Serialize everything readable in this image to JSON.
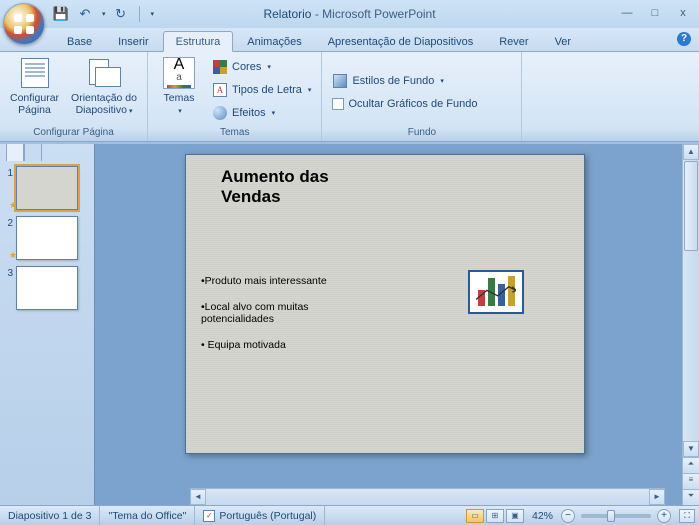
{
  "title": {
    "doc": "Relatorio",
    "app": "Microsoft PowerPoint"
  },
  "qat": {
    "save": "💾",
    "undo": "↶",
    "redo": "↻"
  },
  "window": {
    "min": "—",
    "max": "□",
    "close": "x"
  },
  "tabs": {
    "home": "Base",
    "insert": "Inserir",
    "design": "Estrutura",
    "anim": "Animações",
    "show": "Apresentação de Diapositivos",
    "review": "Rever",
    "view": "Ver"
  },
  "ribbon": {
    "page_setup_group": "Configurar Página",
    "page_setup": "Configurar\nPágina",
    "orientation": "Orientação do\nDiapositivo",
    "themes_group": "Temas",
    "themes": "Temas",
    "colors": "Cores",
    "fonts": "Tipos de Letra",
    "effects": "Efeitos",
    "background_group": "Fundo",
    "bg_styles": "Estilos de Fundo",
    "hide_bg": "Ocultar Gráficos de Fundo"
  },
  "thumbs": {
    "n1": "1",
    "n2": "2",
    "n3": "3"
  },
  "slide": {
    "title": "Aumento das\nVendas",
    "b1": "•Produto mais interessante",
    "b2": "•Local alvo com muitas potencialidades",
    "b3": "• Equipa motivada"
  },
  "status": {
    "slide_of": "Diapositivo 1 de 3",
    "theme": "\"Tema do Office\"",
    "lang": "Português (Portugal)",
    "zoom": "42%"
  }
}
